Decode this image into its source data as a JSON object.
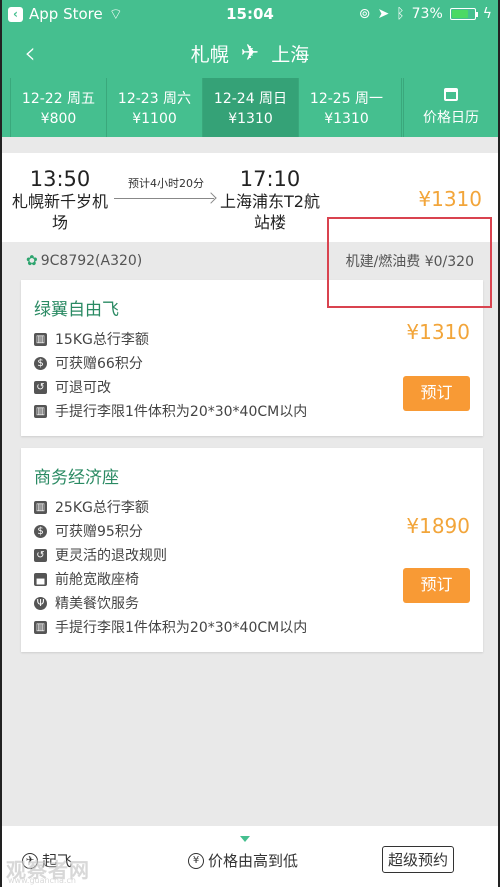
{
  "status_bar": {
    "back_app": "App Store",
    "time": "15:04",
    "battery": "73%",
    "battery_level": 0.73
  },
  "nav": {
    "back_glyph": "‹",
    "origin": "札幌",
    "destination": "上海",
    "plane_glyph": "✈"
  },
  "date_tabs": [
    {
      "date": "12-22 周五",
      "price": "¥800",
      "active": false
    },
    {
      "date": "12-23 周六",
      "price": "¥1100",
      "active": false
    },
    {
      "date": "12-24 周日",
      "price": "¥1310",
      "active": true
    },
    {
      "date": "12-25 周一",
      "price": "¥1310",
      "active": false
    }
  ],
  "calendar_tab": {
    "label": "价格日历"
  },
  "flight": {
    "dep_time": "13:50",
    "dep_airport": "札幌新千岁机场",
    "duration": "预计4小时20分",
    "arr_time": "17:10",
    "arr_airport": "上海浦东T2航站楼",
    "price": "¥1310",
    "flight_no": "9C8792(A320)",
    "tax": "机建/燃油费 ¥0/320"
  },
  "cabins": [
    {
      "title": "绿翼自由飞",
      "price": "¥1310",
      "book_label": "预订",
      "features": [
        {
          "icon": "luggage-icon",
          "text": "15KG总行李额"
        },
        {
          "icon": "points-icon",
          "text": "可获赠66积分"
        },
        {
          "icon": "refund-icon",
          "text": "可退可改"
        },
        {
          "icon": "luggage-icon",
          "text": "手提行李限1件体积为20*30*40CM以内"
        }
      ]
    },
    {
      "title": "商务经济座",
      "price": "¥1890",
      "book_label": "预订",
      "features": [
        {
          "icon": "luggage-icon",
          "text": "25KG总行李额"
        },
        {
          "icon": "points-icon",
          "text": "可获赠95积分"
        },
        {
          "icon": "refund-icon",
          "text": "更灵活的退改规则"
        },
        {
          "icon": "seat-icon",
          "text": "前舱宽敞座椅"
        },
        {
          "icon": "meal-icon",
          "text": "精美餐饮服务"
        },
        {
          "icon": "luggage-icon",
          "text": "手提行李限1件体积为20*30*40CM以内"
        }
      ]
    }
  ],
  "bottom_bar": {
    "depart_label": "起飞",
    "price_sort_label": "价格由高到低",
    "super_booking_label": "超级预约",
    "watermark": "观察者网",
    "watermark_sub": "www.guancha.cn"
  },
  "colors": {
    "brand_green": "#45bf8f",
    "active_tab": "#35a277",
    "price_orange": "#f2a53a",
    "button_orange": "#f89a35",
    "highlight_red": "#d9434f"
  }
}
